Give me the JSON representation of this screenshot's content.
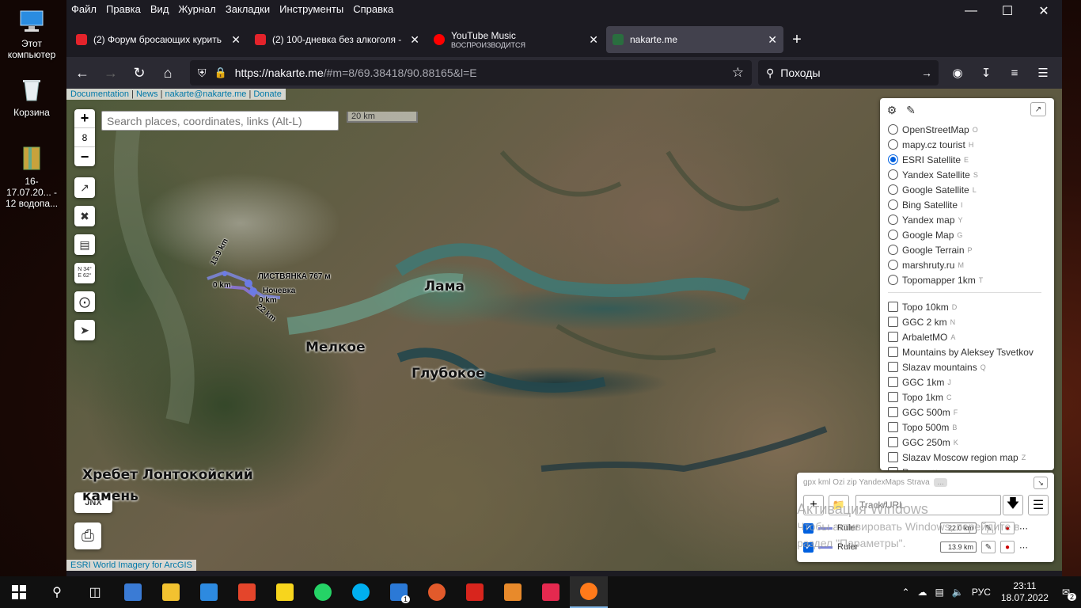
{
  "desktop": {
    "icons": [
      {
        "label": "Этот компьютер",
        "icon": "computer-icon"
      },
      {
        "label": "Корзина",
        "icon": "recycle-bin-icon"
      },
      {
        "label": "16-17.07.20... - 12 водопа...",
        "icon": "archive-file-icon"
      }
    ]
  },
  "browser": {
    "menu": [
      "Файл",
      "Правка",
      "Вид",
      "Журнал",
      "Закладки",
      "Инструменты",
      "Справка"
    ],
    "tabs": [
      {
        "title": "(2) Форум бросающих курить",
        "favicon_color": "#e4232b"
      },
      {
        "title": "(2) 100-дневка без алкоголя -",
        "favicon_color": "#e4232b"
      },
      {
        "title": "YouTube Music",
        "subtitle": "ВОСПРОИЗВОДИТСЯ",
        "favicon_color": "#ff0000"
      },
      {
        "title": "nakarte.me",
        "favicon_color": "#2a6e3f"
      }
    ],
    "url_host": "https://nakarte.me",
    "url_path": "/#m=8/69.38418/90.88165&l=E",
    "search_text": "Походы"
  },
  "map": {
    "top_links": [
      "Documentation",
      "News",
      "nakarte@nakarte.me",
      "Donate"
    ],
    "zoom_level": "8",
    "search_placeholder": "Search places, coordinates, links (Alt-L)",
    "scale_label": "20 km",
    "coords_button": {
      "line1": "N 34°",
      "line2": "E 62°"
    },
    "labels": {
      "lama": "Лама",
      "melkoe": "Мелкое",
      "glubokoe": "Глубокое",
      "khrebet_line1": "Хребет Лонтокойский",
      "khrebet_line2": "камень",
      "listvyanka": "ЛИСТВЯНКА 767 м",
      "nochevka": "Ночевка",
      "km_13_9": "13.9 km",
      "km_0a": "0 km",
      "km_0b": "0 km",
      "km_22": "22 km"
    },
    "attribution": "ESRI World Imagery for ArcGIS",
    "jnx_label": "JNX"
  },
  "layers": {
    "base": [
      {
        "name": "OpenStreetMap",
        "key": "O",
        "selected": false
      },
      {
        "name": "mapy.cz tourist",
        "key": "H",
        "selected": false
      },
      {
        "name": "ESRI Satellite",
        "key": "E",
        "selected": true
      },
      {
        "name": "Yandex Satellite",
        "key": "S",
        "selected": false
      },
      {
        "name": "Google Satellite",
        "key": "L",
        "selected": false
      },
      {
        "name": "Bing Satellite",
        "key": "I",
        "selected": false
      },
      {
        "name": "Yandex map",
        "key": "Y",
        "selected": false
      },
      {
        "name": "Google Map",
        "key": "G",
        "selected": false
      },
      {
        "name": "Google Terrain",
        "key": "P",
        "selected": false
      },
      {
        "name": "marshruty.ru",
        "key": "M",
        "selected": false
      },
      {
        "name": "Topomapper 1km",
        "key": "T",
        "selected": false
      }
    ],
    "overlays": [
      {
        "name": "Topo 10km",
        "key": "D"
      },
      {
        "name": "GGC 2 km",
        "key": "N"
      },
      {
        "name": "ArbaletMO",
        "key": "A"
      },
      {
        "name": "Mountains by Aleksey Tsvetkov",
        "key": ""
      },
      {
        "name": "Slazav mountains",
        "key": "Q"
      },
      {
        "name": "GGC 1km",
        "key": "J"
      },
      {
        "name": "Topo 1km",
        "key": "C"
      },
      {
        "name": "GGC 500m",
        "key": "F"
      },
      {
        "name": "Topo 500m",
        "key": "B"
      },
      {
        "name": "GGC 250m",
        "key": "K"
      },
      {
        "name": "Slazav Moscow region map",
        "key": "Z"
      },
      {
        "name": "Races",
        "key": "U"
      }
    ]
  },
  "tracks": {
    "formats": "gpx kml Ozi zip YandexMaps Strava",
    "more": "...",
    "url_placeholder": "Track/URL",
    "items": [
      {
        "name": "Ruler",
        "length": "22.0 km"
      },
      {
        "name": "Ruler",
        "length": "13.9 km"
      }
    ],
    "watermark_line1": "Активация Windows",
    "watermark_line2": "Чтобы активировать Windows, перейдите в",
    "watermark_line3": "раздел \"Параметры\"."
  },
  "taskbar": {
    "apps": [
      {
        "name": "control-panel-icon",
        "color": "#3a7bd5"
      },
      {
        "name": "explorer-icon",
        "color": "#f2c230"
      },
      {
        "name": "store-icon",
        "color": "#2d8ae0"
      },
      {
        "name": "office-icon",
        "color": "#e4452b"
      },
      {
        "name": "sticky-notes-icon",
        "color": "#f7d51d"
      },
      {
        "name": "whatsapp-icon",
        "color": "#25d366"
      },
      {
        "name": "skype-icon",
        "color": "#00aff0"
      },
      {
        "name": "mail-icon",
        "color": "#2b79d6"
      },
      {
        "name": "photos-icon",
        "color": "#e25a2b"
      },
      {
        "name": "acrobat-icon",
        "color": "#d8251d"
      },
      {
        "name": "archive-icon",
        "color": "#e88a2b"
      },
      {
        "name": "ivi-icon",
        "color": "#e5294f"
      },
      {
        "name": "firefox-icon",
        "color": "#ff7a1a"
      }
    ],
    "language": "РУС",
    "time": "23:11",
    "date": "18.07.2022",
    "notifications": "2",
    "mail_badge": "1"
  }
}
